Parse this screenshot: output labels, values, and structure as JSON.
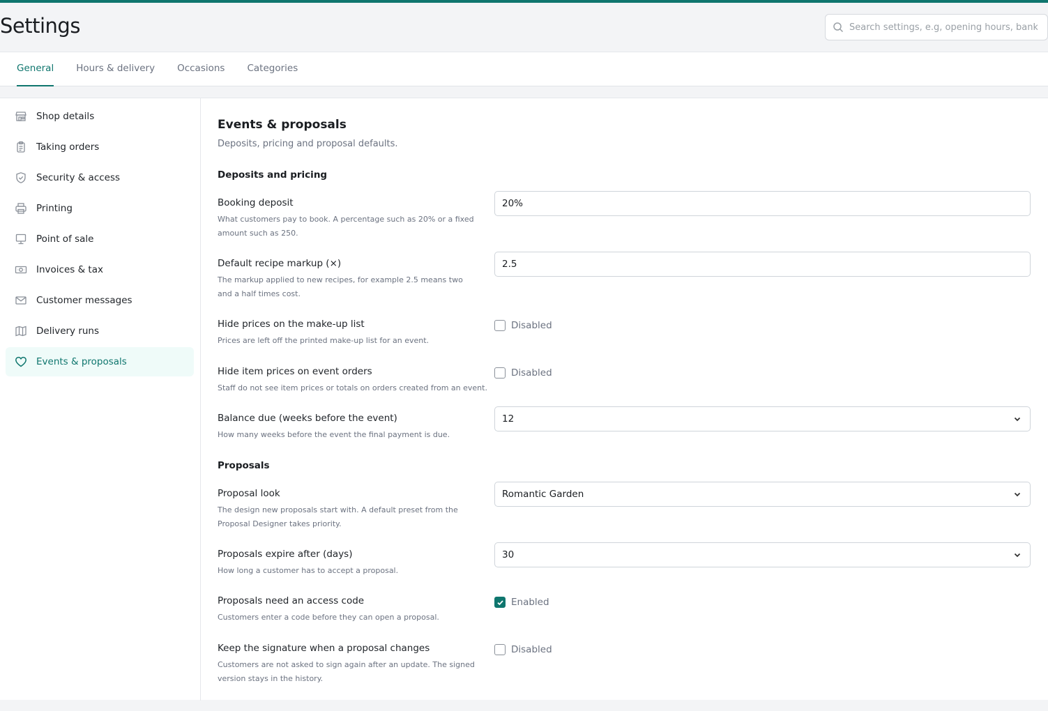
{
  "page": {
    "title": "Settings",
    "accent_color": "#0f766e"
  },
  "search": {
    "placeholder": "Search settings, e.g, opening hours, bank d",
    "icon": "search-icon"
  },
  "tabs": [
    {
      "label": "General",
      "active": true
    },
    {
      "label": "Hours & delivery",
      "active": false
    },
    {
      "label": "Occasions",
      "active": false
    },
    {
      "label": "Categories",
      "active": false
    }
  ],
  "sidebar": {
    "items": [
      {
        "label": "Shop details",
        "icon": "storefront-icon",
        "active": false
      },
      {
        "label": "Taking orders",
        "icon": "clipboard-icon",
        "active": false
      },
      {
        "label": "Security & access",
        "icon": "shield-icon",
        "active": false
      },
      {
        "label": "Printing",
        "icon": "printer-icon",
        "active": false
      },
      {
        "label": "Point of sale",
        "icon": "monitor-icon",
        "active": false
      },
      {
        "label": "Invoices & tax",
        "icon": "banknote-icon",
        "active": false
      },
      {
        "label": "Customer messages",
        "icon": "envelope-icon",
        "active": false
      },
      {
        "label": "Delivery runs",
        "icon": "map-icon",
        "active": false
      },
      {
        "label": "Events & proposals",
        "icon": "heart-icon",
        "active": true
      }
    ]
  },
  "main": {
    "title": "Events & proposals",
    "subtitle": "Deposits, pricing and proposal defaults.",
    "groups": {
      "deposits": "Deposits and pricing",
      "proposals": "Proposals"
    },
    "fields": {
      "booking_deposit": {
        "label": "Booking deposit",
        "help": "What customers pay to book. A percentage such as 20% or a fixed amount such as 250.",
        "value": "20%"
      },
      "recipe_markup": {
        "label": "Default recipe markup (×)",
        "help": "The markup applied to new recipes, for example 2.5 means two and a half times cost.",
        "value": "2.5"
      },
      "hide_makeup_prices": {
        "label": "Hide prices on the make-up list",
        "help": "Prices are left off the printed make-up list for an event.",
        "state": "Disabled",
        "checked": false
      },
      "hide_event_prices": {
        "label": "Hide item prices on event orders",
        "help": "Staff do not see item prices or totals on orders created from an event.",
        "state": "Disabled",
        "checked": false
      },
      "balance_due": {
        "label": "Balance due (weeks before the event)",
        "help": "How many weeks before the event the final payment is due.",
        "value": "12"
      },
      "proposal_look": {
        "label": "Proposal look",
        "help": "The design new proposals start with. A default preset from the Proposal Designer takes priority.",
        "value": "Romantic Garden"
      },
      "proposal_expiry": {
        "label": "Proposals expire after (days)",
        "help": "How long a customer has to accept a proposal.",
        "value": "30"
      },
      "access_code": {
        "label": "Proposals need an access code",
        "help": "Customers enter a code before they can open a proposal.",
        "state": "Enabled",
        "checked": true
      },
      "keep_signature": {
        "label": "Keep the signature when a proposal changes",
        "help": "Customers are not asked to sign again after an update. The signed version stays in the history.",
        "state": "Disabled",
        "checked": false
      }
    }
  }
}
